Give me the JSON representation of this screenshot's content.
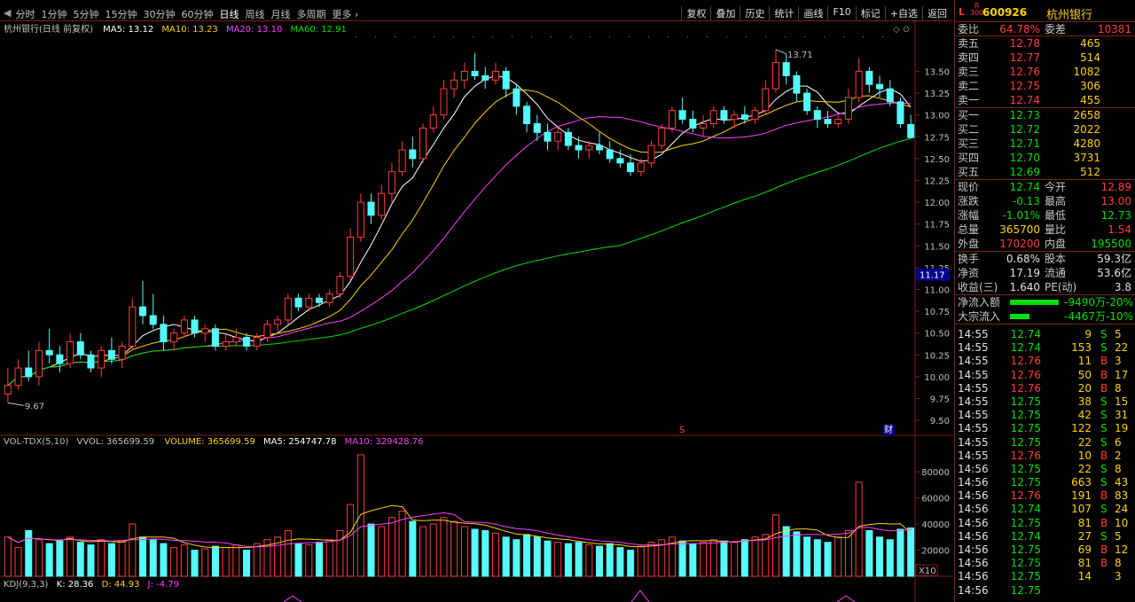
{
  "topbar": {
    "back_glyph": "◀",
    "periods": [
      "分时",
      "1分钟",
      "5分钟",
      "15分钟",
      "30分钟",
      "60分钟",
      "日线",
      "周线",
      "月线",
      "多周期",
      "更多 ›"
    ],
    "active_period": "日线",
    "tools": [
      "复权",
      "叠加",
      "历史",
      "统计",
      "画线",
      "F10",
      "标记",
      "+自选",
      "返回"
    ]
  },
  "main_legend": {
    "title": "杭州银行(日线 前复权)",
    "ma5": "MA5: 13.12",
    "ma10": "MA10: 13.23",
    "ma20": "MA20: 13.10",
    "ma60": "MA60: 12.91"
  },
  "price_axis": [
    "13.50",
    "13.25",
    "13.00",
    "12.75",
    "12.50",
    "12.25",
    "12.00",
    "11.75",
    "11.50",
    "11.25",
    "11.00",
    "10.75",
    "10.50",
    "10.25",
    "10.00",
    "9.75",
    "9.50"
  ],
  "price_marker": "11.17",
  "high_label": "13.71",
  "low_label": "9.67",
  "event_markers": [
    "S",
    "财"
  ],
  "vol_legend": {
    "title": "VOL-TDX(5,10)",
    "vvol": "VVOL: 365699.59",
    "volume": "VOLUME: 365699.59",
    "ma5": "MA5: 254747.78",
    "ma10": "MA10: 329428.76"
  },
  "vol_axis": [
    "80000",
    "60000",
    "40000",
    "20000"
  ],
  "vol_unit": "X10",
  "kdj_legend": {
    "title": "KDJ(9,3,3)",
    "k": "K: 28.36",
    "d": "D: 44.93",
    "j": "J: -4.79"
  },
  "chart_data": {
    "type": "candlestick",
    "title": "杭州银行(日线 前复权)",
    "y_range": [
      9.45,
      13.85
    ],
    "vol_range": [
      0,
      95000
    ],
    "ohlc": [
      [
        9.8,
        10.1,
        9.7,
        9.9
      ],
      [
        9.9,
        10.2,
        9.85,
        10.1
      ],
      [
        10.1,
        10.3,
        9.95,
        10.0
      ],
      [
        10.0,
        10.4,
        9.9,
        10.3
      ],
      [
        10.3,
        10.55,
        10.15,
        10.25
      ],
      [
        10.25,
        10.35,
        10.05,
        10.15
      ],
      [
        10.15,
        10.5,
        10.1,
        10.4
      ],
      [
        10.4,
        10.5,
        10.2,
        10.25
      ],
      [
        10.25,
        10.3,
        10.05,
        10.1
      ],
      [
        10.1,
        10.35,
        10.0,
        10.3
      ],
      [
        10.3,
        10.45,
        10.15,
        10.2
      ],
      [
        10.2,
        10.4,
        10.1,
        10.35
      ],
      [
        10.35,
        10.9,
        10.3,
        10.8
      ],
      [
        10.8,
        11.1,
        10.6,
        10.7
      ],
      [
        10.7,
        10.95,
        10.55,
        10.6
      ],
      [
        10.6,
        10.7,
        10.3,
        10.4
      ],
      [
        10.4,
        10.55,
        10.3,
        10.5
      ],
      [
        10.5,
        10.7,
        10.45,
        10.65
      ],
      [
        10.65,
        10.7,
        10.45,
        10.5
      ],
      [
        10.5,
        10.6,
        10.4,
        10.55
      ],
      [
        10.55,
        10.6,
        10.3,
        10.35
      ],
      [
        10.35,
        10.5,
        10.3,
        10.4
      ],
      [
        10.4,
        10.55,
        10.35,
        10.45
      ],
      [
        10.45,
        10.5,
        10.3,
        10.35
      ],
      [
        10.35,
        10.5,
        10.3,
        10.45
      ],
      [
        10.45,
        10.65,
        10.4,
        10.6
      ],
      [
        10.6,
        10.7,
        10.5,
        10.65
      ],
      [
        10.65,
        10.95,
        10.6,
        10.9
      ],
      [
        10.9,
        10.95,
        10.75,
        10.8
      ],
      [
        10.8,
        10.95,
        10.75,
        10.9
      ],
      [
        10.9,
        10.95,
        10.8,
        10.85
      ],
      [
        10.85,
        11.0,
        10.8,
        10.95
      ],
      [
        10.95,
        11.2,
        10.9,
        11.15
      ],
      [
        11.15,
        11.7,
        11.1,
        11.6
      ],
      [
        11.6,
        12.1,
        11.55,
        12.0
      ],
      [
        12.0,
        12.1,
        11.75,
        11.85
      ],
      [
        11.85,
        12.2,
        11.8,
        12.1
      ],
      [
        12.1,
        12.45,
        12.0,
        12.35
      ],
      [
        12.35,
        12.7,
        12.3,
        12.6
      ],
      [
        12.6,
        12.75,
        12.4,
        12.5
      ],
      [
        12.5,
        12.9,
        12.45,
        12.85
      ],
      [
        12.85,
        13.1,
        12.8,
        13.0
      ],
      [
        13.0,
        13.4,
        12.95,
        13.3
      ],
      [
        13.3,
        13.5,
        13.2,
        13.4
      ],
      [
        13.4,
        13.6,
        13.3,
        13.5
      ],
      [
        13.5,
        13.71,
        13.4,
        13.45
      ],
      [
        13.45,
        13.55,
        13.3,
        13.4
      ],
      [
        13.4,
        13.6,
        13.35,
        13.5
      ],
      [
        13.5,
        13.55,
        13.2,
        13.3
      ],
      [
        13.3,
        13.35,
        13.0,
        13.1
      ],
      [
        13.1,
        13.15,
        12.8,
        12.9
      ],
      [
        12.9,
        13.0,
        12.7,
        12.8
      ],
      [
        12.8,
        12.9,
        12.6,
        12.7
      ],
      [
        12.7,
        12.85,
        12.6,
        12.8
      ],
      [
        12.8,
        12.85,
        12.6,
        12.65
      ],
      [
        12.65,
        12.75,
        12.5,
        12.6
      ],
      [
        12.6,
        12.7,
        12.5,
        12.65
      ],
      [
        12.65,
        12.8,
        12.55,
        12.6
      ],
      [
        12.6,
        12.7,
        12.45,
        12.5
      ],
      [
        12.5,
        12.6,
        12.4,
        12.45
      ],
      [
        12.45,
        12.55,
        12.3,
        12.35
      ],
      [
        12.35,
        12.5,
        12.3,
        12.45
      ],
      [
        12.45,
        12.7,
        12.4,
        12.65
      ],
      [
        12.65,
        12.9,
        12.6,
        12.85
      ],
      [
        12.85,
        13.1,
        12.8,
        13.05
      ],
      [
        13.05,
        13.2,
        12.9,
        12.95
      ],
      [
        12.95,
        13.05,
        12.8,
        12.85
      ],
      [
        12.85,
        13.0,
        12.75,
        12.9
      ],
      [
        12.9,
        13.1,
        12.85,
        13.05
      ],
      [
        13.05,
        13.1,
        12.9,
        12.95
      ],
      [
        12.95,
        13.05,
        12.85,
        13.0
      ],
      [
        13.0,
        13.1,
        12.9,
        12.95
      ],
      [
        12.95,
        13.1,
        12.9,
        13.05
      ],
      [
        13.05,
        13.4,
        13.0,
        13.3
      ],
      [
        13.3,
        13.75,
        13.25,
        13.6
      ],
      [
        13.6,
        13.7,
        13.35,
        13.45
      ],
      [
        13.45,
        13.5,
        13.15,
        13.25
      ],
      [
        13.25,
        13.3,
        13.0,
        13.05
      ],
      [
        13.05,
        13.1,
        12.85,
        12.95
      ],
      [
        12.95,
        13.05,
        12.85,
        12.9
      ],
      [
        12.9,
        13.0,
        12.85,
        12.95
      ],
      [
        12.95,
        13.3,
        12.9,
        13.2
      ],
      [
        13.2,
        13.65,
        13.15,
        13.5
      ],
      [
        13.5,
        13.55,
        13.25,
        13.35
      ],
      [
        13.35,
        13.45,
        13.2,
        13.3
      ],
      [
        13.3,
        13.4,
        13.1,
        13.15
      ],
      [
        13.15,
        13.2,
        12.85,
        12.9
      ],
      [
        12.89,
        13.0,
        12.73,
        12.74
      ]
    ],
    "volume": [
      30000,
      22000,
      35000,
      28000,
      25000,
      27000,
      30000,
      26000,
      24000,
      28000,
      25000,
      27000,
      40000,
      30000,
      28000,
      25000,
      22000,
      24000,
      20000,
      21000,
      23000,
      22000,
      24000,
      20000,
      25000,
      28000,
      30000,
      35000,
      25000,
      24000,
      26000,
      28000,
      35000,
      55000,
      93000,
      40000,
      38000,
      45000,
      50000,
      42000,
      38000,
      40000,
      45000,
      42000,
      38000,
      36000,
      35000,
      33000,
      30000,
      28000,
      32000,
      30000,
      27000,
      26000,
      25000,
      26000,
      24000,
      23000,
      25000,
      22000,
      20000,
      23000,
      26000,
      28000,
      30000,
      27000,
      25000,
      26000,
      28000,
      27000,
      26000,
      28000,
      30000,
      32000,
      47000,
      38000,
      34000,
      30000,
      28000,
      26000,
      30000,
      35000,
      72000,
      35000,
      30000,
      28000,
      36000,
      37000
    ],
    "kdj": {
      "k": 28.36,
      "d": 44.93,
      "j": -4.79
    }
  },
  "quote": {
    "label": "L",
    "r_top": "R",
    "r_bottom": "300",
    "code": "600926",
    "name": "杭州银行",
    "weibi_label": "委比",
    "weibi": "64.78%",
    "weicha_label": "委差",
    "weicha": "10381",
    "asks": [
      {
        "label": "卖五",
        "price": "12.78",
        "vol": "465"
      },
      {
        "label": "卖四",
        "price": "12.77",
        "vol": "514"
      },
      {
        "label": "卖三",
        "price": "12.76",
        "vol": "1082"
      },
      {
        "label": "卖二",
        "price": "12.75",
        "vol": "306"
      },
      {
        "label": "卖一",
        "price": "12.74",
        "vol": "455"
      }
    ],
    "bids": [
      {
        "label": "买一",
        "price": "12.73",
        "vol": "2658"
      },
      {
        "label": "买二",
        "price": "12.72",
        "vol": "2022"
      },
      {
        "label": "买三",
        "price": "12.71",
        "vol": "4280"
      },
      {
        "label": "买四",
        "price": "12.70",
        "vol": "3731"
      },
      {
        "label": "买五",
        "price": "12.69",
        "vol": "512"
      }
    ],
    "stats": [
      {
        "l1": "现价",
        "v1": "12.74",
        "c1": "grn",
        "l2": "今开",
        "v2": "12.89",
        "c2": "red"
      },
      {
        "l1": "涨跌",
        "v1": "-0.13",
        "c1": "grn",
        "l2": "最高",
        "v2": "13.00",
        "c2": "red"
      },
      {
        "l1": "涨幅",
        "v1": "-1.01%",
        "c1": "grn",
        "l2": "最低",
        "v2": "12.73",
        "c2": "grn"
      },
      {
        "l1": "总量",
        "v1": "365700",
        "c1": "yel",
        "l2": "量比",
        "v2": "1.54",
        "c2": "red"
      },
      {
        "l1": "外盘",
        "v1": "170200",
        "c1": "red",
        "l2": "内盘",
        "v2": "195500",
        "c2": "grn"
      }
    ],
    "fund": [
      {
        "l1": "换手",
        "v1": "0.68%",
        "l2": "股本",
        "v2": "59.3亿"
      },
      {
        "l1": "净资",
        "v1": "17.19",
        "l2": "流通",
        "v2": "53.6亿"
      },
      {
        "l1": "收益(三)",
        "v1": "1.640",
        "l2": "PE(动)",
        "v2": "3.8"
      }
    ],
    "flows": [
      {
        "label": "净流入额",
        "value": "-9490万",
        "pct": "-20%",
        "bar": 55
      },
      {
        "label": "大宗流入",
        "value": "-4467万",
        "pct": "-10%",
        "bar": 22
      }
    ],
    "ticks": [
      {
        "t": "14:55",
        "p": "12.74",
        "v": "9",
        "s": "S",
        "n": "5"
      },
      {
        "t": "14:55",
        "p": "12.74",
        "v": "153",
        "s": "S",
        "n": "22"
      },
      {
        "t": "14:55",
        "p": "12.76",
        "v": "11",
        "s": "B",
        "n": "3"
      },
      {
        "t": "14:55",
        "p": "12.76",
        "v": "50",
        "s": "B",
        "n": "17"
      },
      {
        "t": "14:55",
        "p": "12.76",
        "v": "20",
        "s": "B",
        "n": "8"
      },
      {
        "t": "14:55",
        "p": "12.75",
        "v": "38",
        "s": "S",
        "n": "15"
      },
      {
        "t": "14:55",
        "p": "12.75",
        "v": "42",
        "s": "S",
        "n": "31"
      },
      {
        "t": "14:55",
        "p": "12.75",
        "v": "122",
        "s": "S",
        "n": "19"
      },
      {
        "t": "14:55",
        "p": "12.75",
        "v": "22",
        "s": "S",
        "n": "6"
      },
      {
        "t": "14:55",
        "p": "12.76",
        "v": "10",
        "s": "B",
        "n": "2"
      },
      {
        "t": "14:56",
        "p": "12.75",
        "v": "22",
        "s": "S",
        "n": "8"
      },
      {
        "t": "14:56",
        "p": "12.75",
        "v": "663",
        "s": "S",
        "n": "43",
        "vc": "mag"
      },
      {
        "t": "14:56",
        "p": "12.76",
        "v": "191",
        "s": "B",
        "n": "83"
      },
      {
        "t": "14:56",
        "p": "12.74",
        "v": "107",
        "s": "S",
        "n": "24"
      },
      {
        "t": "14:56",
        "p": "12.75",
        "v": "81",
        "s": "B",
        "n": "10"
      },
      {
        "t": "14:56",
        "p": "12.74",
        "v": "27",
        "s": "S",
        "n": "5"
      },
      {
        "t": "14:56",
        "p": "12.75",
        "v": "69",
        "s": "B",
        "n": "12"
      },
      {
        "t": "14:56",
        "p": "12.75",
        "v": "81",
        "s": "B",
        "n": "8"
      },
      {
        "t": "14:56",
        "p": "12.75",
        "v": "14",
        "s": "",
        "n": "3"
      },
      {
        "t": "14:56",
        "p": "12.75",
        "v": "",
        "s": "",
        "n": ""
      }
    ]
  },
  "colors": {
    "up": "#ff3c3c",
    "down": "#54fcfc",
    "ma5": "#ffffff",
    "ma10": "#ffd200",
    "ma20": "#ff40ff",
    "ma60": "#00e000",
    "grid": "#7b1e1e"
  }
}
